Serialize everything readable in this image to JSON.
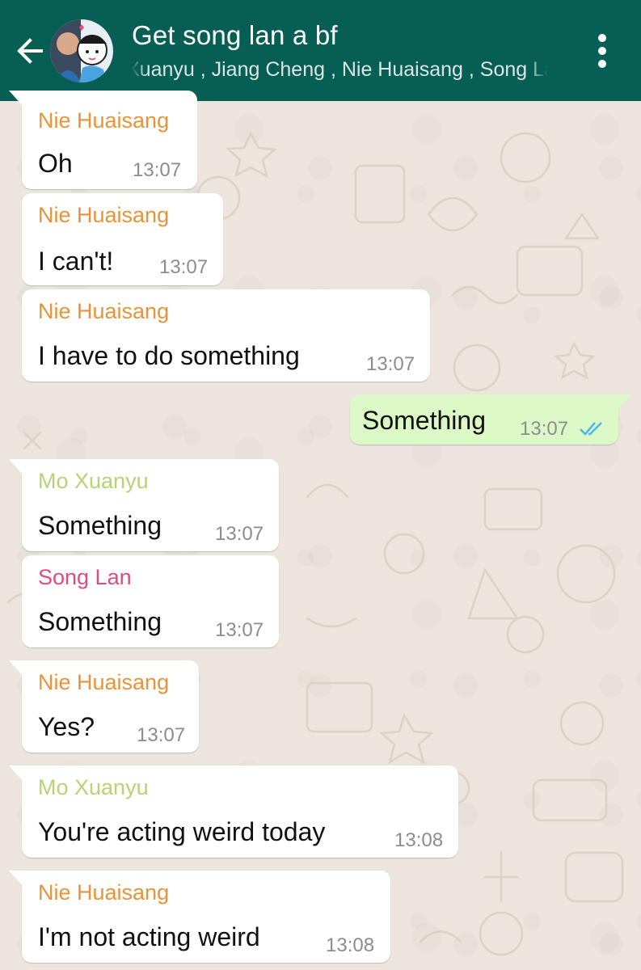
{
  "header": {
    "title": "Get song lan a bf",
    "members": "Xuanyu , Jiang Cheng , Nie Huaisang , Song Lan",
    "background": "#075E54",
    "back_icon": "arrow-left-icon",
    "menu_icon": "more-vertical-icon"
  },
  "colors": {
    "wallpaper": "#ECE5DD",
    "incoming_bubble": "#FFFFFF",
    "outgoing_bubble": "#DCF8C6",
    "read_ticks": "#4FB6EC",
    "nie_huaisang": "#E8933A",
    "mo_xuanyu": "#B5D472",
    "song_lan": "#DE4B84"
  },
  "messages": [
    {
      "sender": "Nie Huaisang",
      "text": "Oh",
      "time": "13:07",
      "direction": "in"
    },
    {
      "sender": "Nie Huaisang",
      "text": "I can't!",
      "time": "13:07",
      "direction": "in"
    },
    {
      "sender": "Nie Huaisang",
      "text": "I have to do something",
      "time": "13:07",
      "direction": "in"
    },
    {
      "sender": "",
      "text": "Something",
      "time": "13:07",
      "direction": "out",
      "status": "read"
    },
    {
      "sender": "Mo Xuanyu",
      "text": "Something",
      "time": "13:07",
      "direction": "in"
    },
    {
      "sender": "Song Lan",
      "text": "Something",
      "time": "13:07",
      "direction": "in"
    },
    {
      "sender": "Nie Huaisang",
      "text": "Yes?",
      "time": "13:07",
      "direction": "in"
    },
    {
      "sender": "Mo Xuanyu",
      "text": "You're acting weird today",
      "time": "13:08",
      "direction": "in"
    },
    {
      "sender": "Nie Huaisang",
      "text": "I'm not acting weird",
      "time": "13:08",
      "direction": "in"
    }
  ]
}
